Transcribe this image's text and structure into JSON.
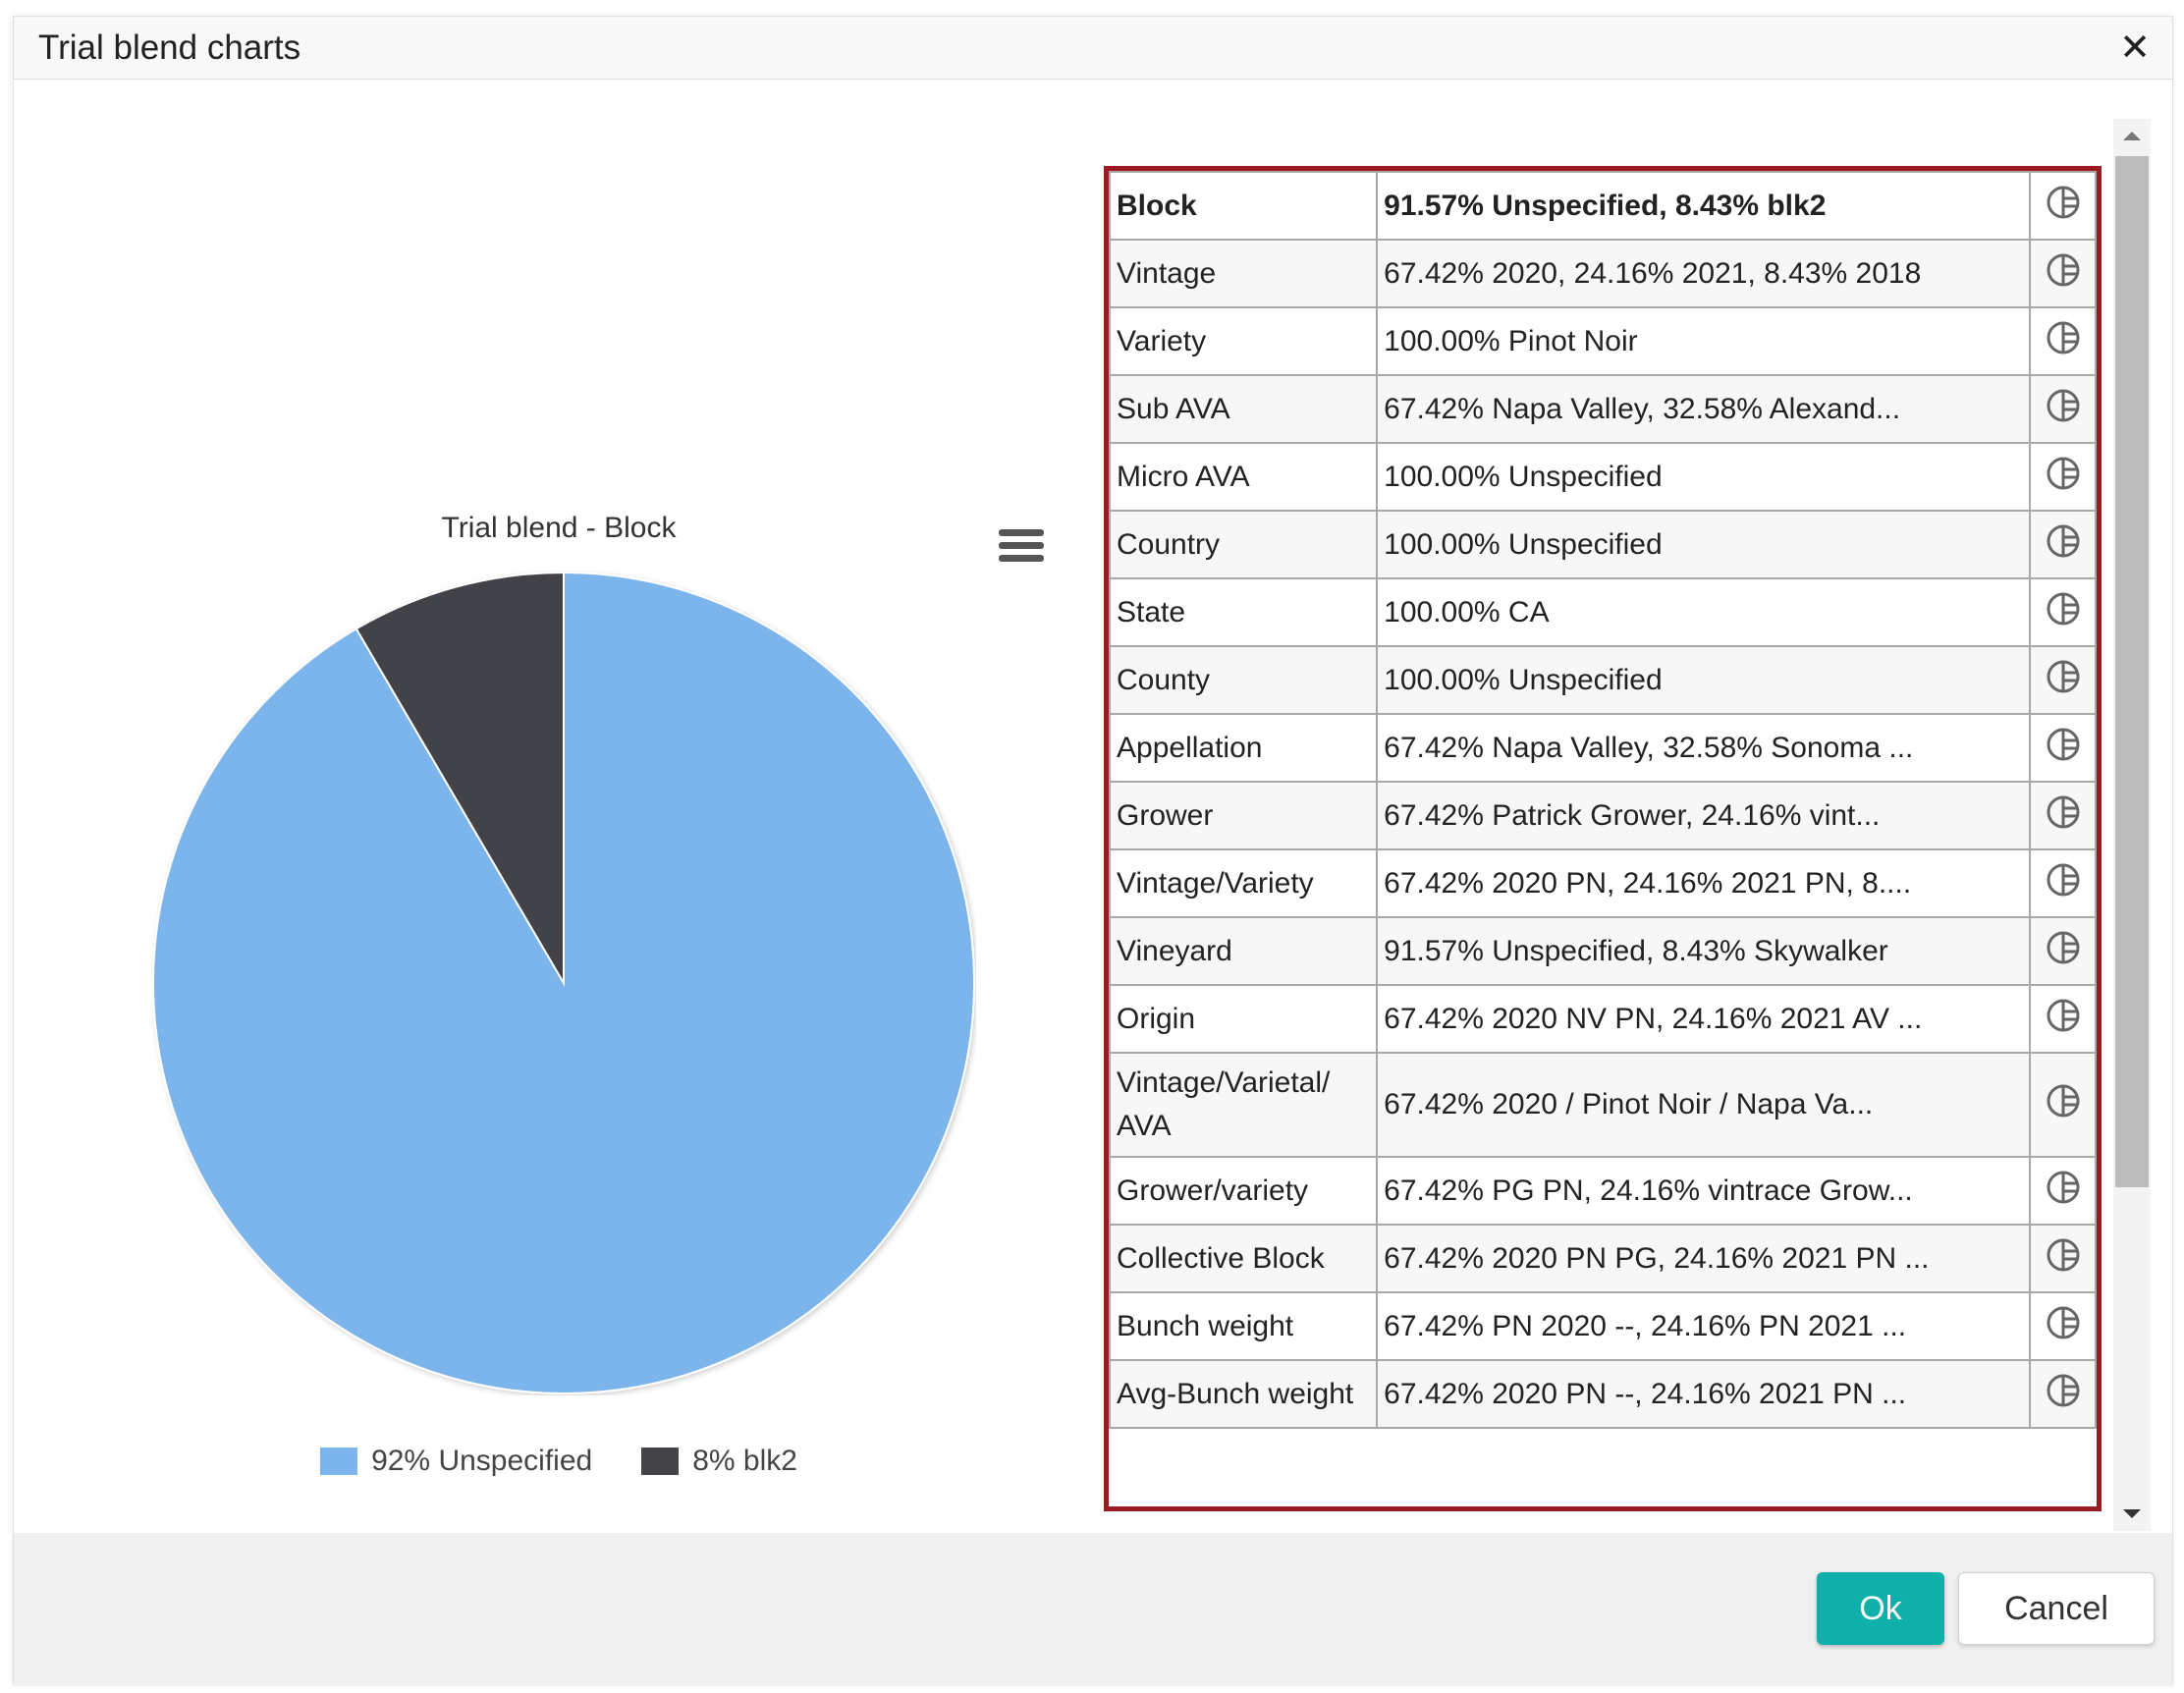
{
  "dialog": {
    "title": "Trial blend charts",
    "ok_label": "Ok",
    "cancel_label": "Cancel"
  },
  "chart_data": {
    "type": "pie",
    "title": "Trial blend - Block",
    "categories": [
      "Unspecified",
      "blk2"
    ],
    "values": [
      91.57,
      8.43
    ],
    "legend_labels": [
      "92% Unspecified",
      "8% blk2"
    ],
    "colors": [
      "#7cb5ec",
      "#434348"
    ],
    "legend_position": "bottom"
  },
  "table": {
    "rows": [
      {
        "label": "Block",
        "value": "91.57% Unspecified, 8.43% blk2"
      },
      {
        "label": "Vintage",
        "value": "67.42% 2020, 24.16% 2021, 8.43% 2018"
      },
      {
        "label": "Variety",
        "value": "100.00% Pinot Noir"
      },
      {
        "label": "Sub AVA",
        "value": "67.42% Napa Valley, 32.58% Alexand..."
      },
      {
        "label": "Micro AVA",
        "value": "100.00% Unspecified"
      },
      {
        "label": "Country",
        "value": "100.00% Unspecified"
      },
      {
        "label": "State",
        "value": "100.00% CA"
      },
      {
        "label": "County",
        "value": "100.00% Unspecified"
      },
      {
        "label": "Appellation",
        "value": "67.42% Napa Valley, 32.58% Sonoma ..."
      },
      {
        "label": "Grower",
        "value": "67.42% Patrick Grower, 24.16% vint..."
      },
      {
        "label": "Vintage/Variety",
        "value": "67.42% 2020 PN, 24.16% 2021 PN, 8...."
      },
      {
        "label": "Vineyard",
        "value": "91.57% Unspecified, 8.43% Skywalker"
      },
      {
        "label": "Origin",
        "value": "67.42% 2020 NV PN, 24.16% 2021 AV ..."
      },
      {
        "label": "Vintage/Varietal/ AVA",
        "value": "67.42% 2020 / Pinot Noir / Napa Va..."
      },
      {
        "label": "Grower/variety",
        "value": "67.42% PG PN, 24.16% vintrace Grow..."
      },
      {
        "label": "Collective Block",
        "value": "67.42% 2020 PN PG, 24.16% 2021 PN ..."
      },
      {
        "label": "Bunch weight",
        "value": "67.42% PN 2020 --, 24.16% PN 2021 ..."
      },
      {
        "label": "Avg-Bunch weight",
        "value": "67.42% 2020 PN --, 24.16% 2021 PN ..."
      }
    ],
    "row_icon": "pie-chart-icon"
  }
}
